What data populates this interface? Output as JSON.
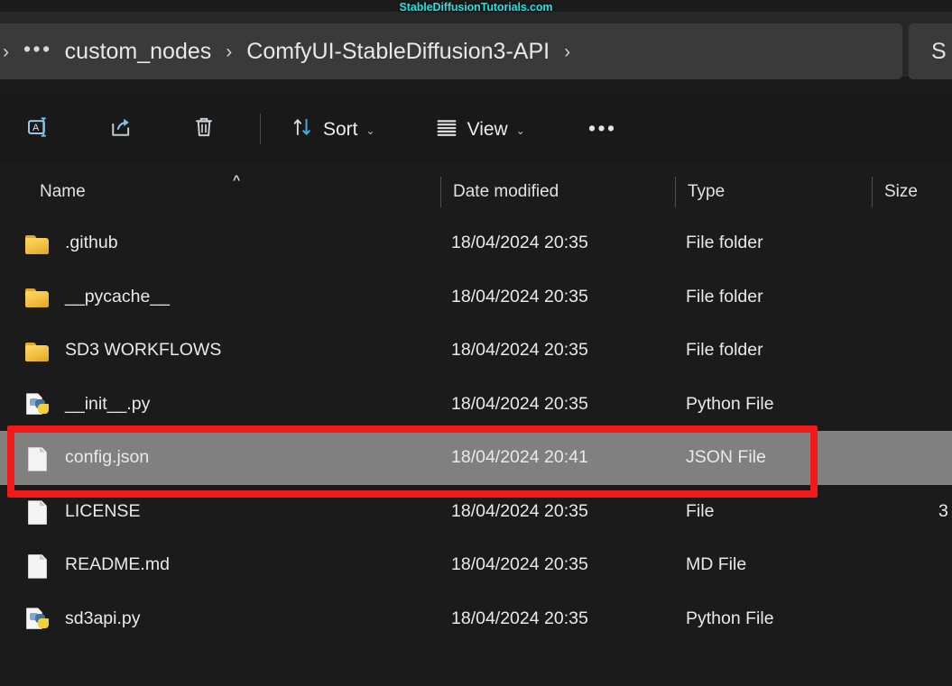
{
  "watermark": {
    "text": "StableDiffusionTutorials.com",
    "color": "#15e6e6"
  },
  "address_bar": {
    "leading_chevron": "›",
    "overflow_label": "•••",
    "separator": "›",
    "crumbs": [
      {
        "label": "custom_nodes"
      },
      {
        "label": "ComfyUI-StableDiffusion3-API"
      }
    ],
    "trailing_separator": "›"
  },
  "search": {
    "visible_text": "S"
  },
  "toolbar": {
    "rename_icon": "rename-icon",
    "share_icon": "share-icon",
    "delete_icon": "delete-icon",
    "sort_label": "Sort",
    "sort_icon": "sort-arrows-icon",
    "view_label": "View",
    "view_icon": "view-list-icon",
    "chevron": "⌄",
    "more_label": "•••"
  },
  "columns": {
    "name": "Name",
    "date_modified": "Date modified",
    "type": "Type",
    "size": "Size",
    "sort_caret": "^"
  },
  "files": [
    {
      "icon": "folder-icon",
      "name": ".github",
      "date": "18/04/2024 20:35",
      "type": "File folder",
      "size": "",
      "selected": false
    },
    {
      "icon": "folder-icon",
      "name": "__pycache__",
      "date": "18/04/2024 20:35",
      "type": "File folder",
      "size": "",
      "selected": false
    },
    {
      "icon": "folder-icon",
      "name": "SD3 WORKFLOWS",
      "date": "18/04/2024 20:35",
      "type": "File folder",
      "size": "",
      "selected": false
    },
    {
      "icon": "python-file-icon",
      "name": "__init__.py",
      "date": "18/04/2024 20:35",
      "type": "Python File",
      "size": "",
      "selected": false
    },
    {
      "icon": "json-file-icon",
      "name": "config.json",
      "date": "18/04/2024 20:41",
      "type": "JSON File",
      "size": "",
      "selected": true
    },
    {
      "icon": "file-icon",
      "name": "LICENSE",
      "date": "18/04/2024 20:35",
      "type": "File",
      "size": "3",
      "selected": false
    },
    {
      "icon": "md-file-icon",
      "name": "README.md",
      "date": "18/04/2024 20:35",
      "type": "MD File",
      "size": "",
      "selected": false
    },
    {
      "icon": "python-file-icon",
      "name": "sd3api.py",
      "date": "18/04/2024 20:35",
      "type": "Python File",
      "size": "",
      "selected": false
    }
  ],
  "annotation": {
    "shape": "rectangle",
    "color": "#f01a1a",
    "targets": "config.json"
  }
}
